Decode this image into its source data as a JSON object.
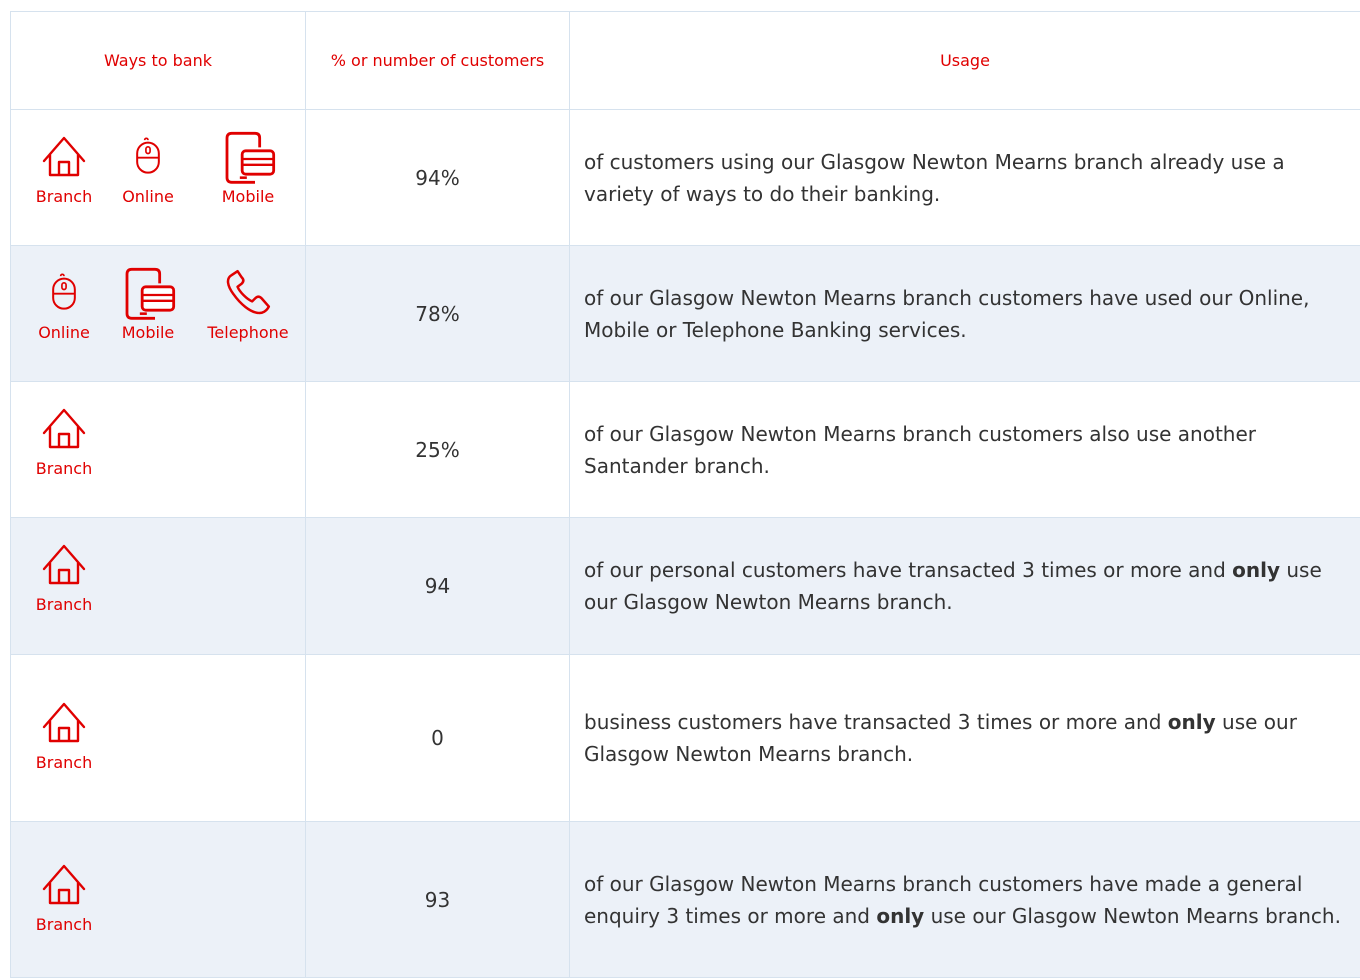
{
  "colors": {
    "accent": "#e00000",
    "alt_row": "#ecf1f8",
    "border": "#d6e2ee"
  },
  "headers": {
    "ways": "Ways to bank",
    "percent": "% or number of customers",
    "usage": "Usage"
  },
  "rows": [
    {
      "icons": [
        {
          "icon": "branch-icon",
          "label": "Branch"
        },
        {
          "icon": "mouse-icon",
          "label": "Online"
        },
        {
          "icon": "mobile-icon",
          "label": "Mobile"
        }
      ],
      "value": "94%",
      "usage_before": "of customers using our Glasgow Newton Mearns branch already use a variety of ways to do their banking.",
      "usage_bold": "",
      "usage_after": ""
    },
    {
      "icons": [
        {
          "icon": "mouse-icon",
          "label": "Online"
        },
        {
          "icon": "mobile-icon",
          "label": "Mobile"
        },
        {
          "icon": "phone-icon",
          "label": "Telephone"
        }
      ],
      "value": "78%",
      "usage_before": "of our Glasgow Newton Mearns branch customers have used our Online, Mobile or Telephone Banking services.",
      "usage_bold": "",
      "usage_after": ""
    },
    {
      "icons": [
        {
          "icon": "branch-icon",
          "label": "Branch"
        }
      ],
      "value": "25%",
      "usage_before": "of our Glasgow Newton Mearns branch customers also use another Santander branch.",
      "usage_bold": "",
      "usage_after": ""
    },
    {
      "icons": [
        {
          "icon": "branch-icon",
          "label": "Branch"
        }
      ],
      "value": "94",
      "usage_before": "of our personal customers have transacted 3 times or more and ",
      "usage_bold": "only",
      "usage_after": " use our Glasgow Newton Mearns branch."
    },
    {
      "icons": [
        {
          "icon": "branch-icon",
          "label": "Branch"
        }
      ],
      "value": "0",
      "usage_before": "business customers have transacted 3 times or more and ",
      "usage_bold": "only",
      "usage_after": " use our Glasgow Newton Mearns branch."
    },
    {
      "icons": [
        {
          "icon": "branch-icon",
          "label": "Branch"
        }
      ],
      "value": "93",
      "usage_before": "of our Glasgow Newton Mearns branch customers have made a general enquiry 3 times or more and ",
      "usage_bold": "only",
      "usage_after": " use our Glasgow Newton Mearns branch."
    }
  ]
}
